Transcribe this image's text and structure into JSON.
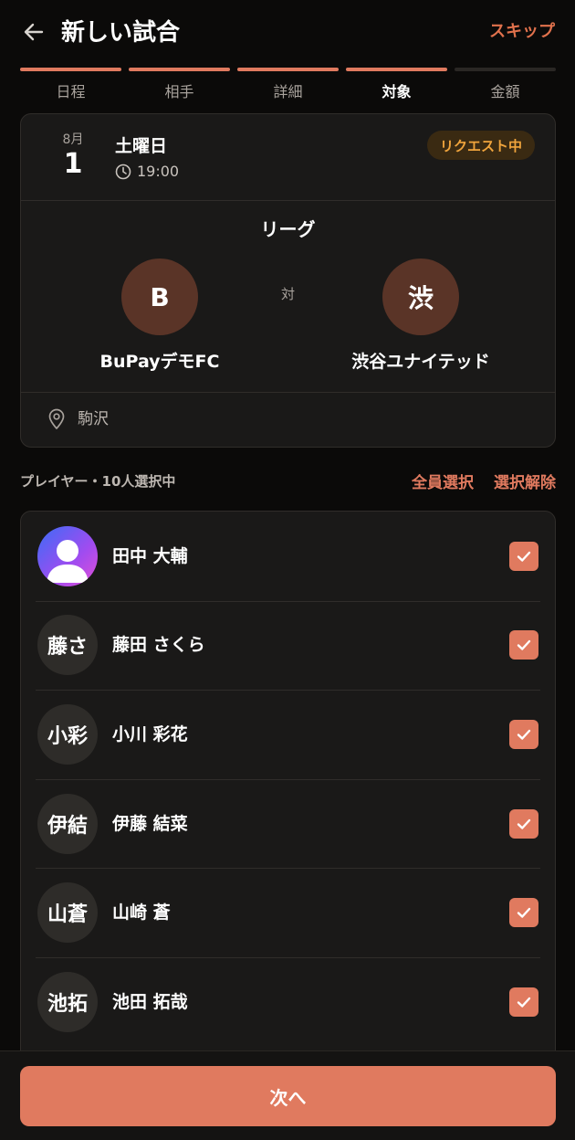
{
  "header": {
    "title": "新しい試合",
    "skip_label": "スキップ",
    "back_icon": "arrow-left-icon"
  },
  "steps": [
    {
      "label": "日程",
      "state": "done"
    },
    {
      "label": "相手",
      "state": "done"
    },
    {
      "label": "詳細",
      "state": "done"
    },
    {
      "label": "対象",
      "state": "current"
    },
    {
      "label": "金額",
      "state": "todo"
    }
  ],
  "match": {
    "month": "8月",
    "day": "1",
    "weekday": "土曜日",
    "time": "19:00",
    "status": "リクエスト中",
    "league": "リーグ",
    "vs": "対",
    "home": {
      "initial": "B",
      "name": "BuPayデモFC"
    },
    "away": {
      "initial": "渋",
      "name": "渋谷ユナイテッド"
    },
    "venue": "駒沢"
  },
  "players_section": {
    "count_label": "プレイヤー・10人選択中",
    "select_all": "全員選択",
    "deselect_all": "選択解除"
  },
  "players": [
    {
      "initials": "",
      "name": "田中 大輔",
      "photo": true,
      "checked": true
    },
    {
      "initials": "藤さ",
      "name": "藤田 さくら",
      "photo": false,
      "checked": true
    },
    {
      "initials": "小彩",
      "name": "小川 彩花",
      "photo": false,
      "checked": true
    },
    {
      "initials": "伊結",
      "name": "伊藤 結菜",
      "photo": false,
      "checked": true
    },
    {
      "initials": "山蒼",
      "name": "山崎 蒼",
      "photo": false,
      "checked": true
    },
    {
      "initials": "池拓",
      "name": "池田 拓哉",
      "photo": false,
      "checked": true
    }
  ],
  "footer": {
    "next_label": "次へ"
  },
  "colors": {
    "accent": "#e07a5f",
    "background": "#0b0a09",
    "card": "#1a1918",
    "badge_text": "#f0a43c"
  }
}
